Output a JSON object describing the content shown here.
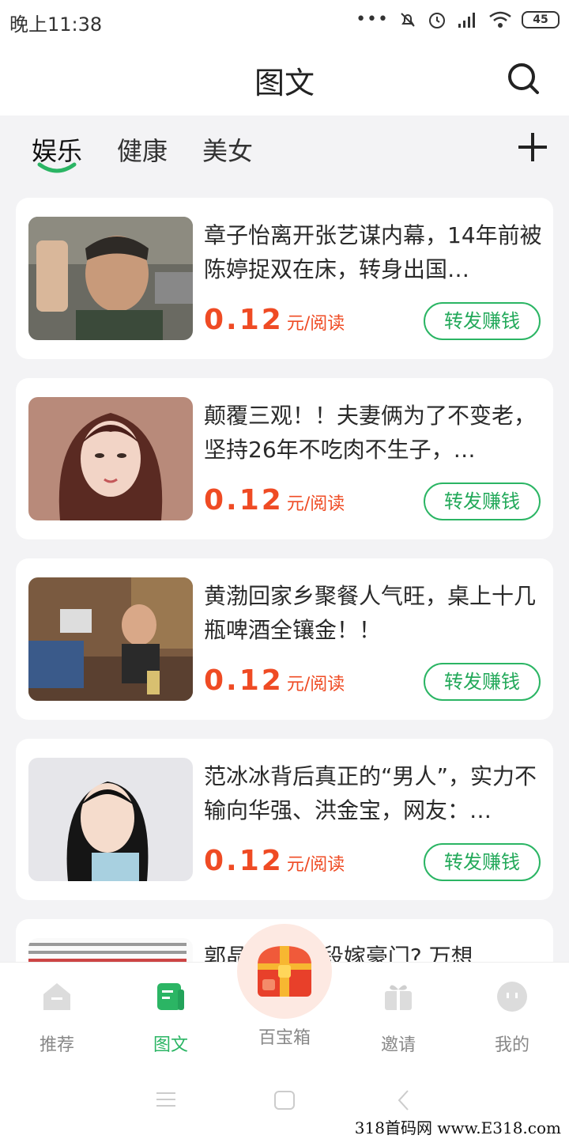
{
  "status_bar": {
    "time": "晚上11:38",
    "battery": "45"
  },
  "header": {
    "title": "图文",
    "search_icon": "search-icon"
  },
  "tabs": [
    {
      "label": "娱乐",
      "active": true
    },
    {
      "label": "健康",
      "active": false
    },
    {
      "label": "美女",
      "active": false
    }
  ],
  "add_icon": "plus-icon",
  "articles": [
    {
      "title": "章子怡离开张艺谋内幕，14年前被陈婷捉双在床，转身出国…",
      "price": "0.12",
      "unit": "元/阅读",
      "action": "转发赚钱"
    },
    {
      "title": "颠覆三观！！夫妻俩为了不变老，坚持26年不吃肉不生子，…",
      "price": "0.12",
      "unit": "元/阅读",
      "action": "转发赚钱"
    },
    {
      "title": "黄渤回家乡聚餐人气旺，桌上十几瓶啤酒全镶金！！",
      "price": "0.12",
      "unit": "元/阅读",
      "action": "转发赚钱"
    },
    {
      "title": "范冰冰背后真正的“男人”，实力不输向华强、洪金宝，网友：…",
      "price": "0.12",
      "unit": "元/阅读",
      "action": "转发赚钱"
    },
    {
      "title": "郭晶 曝靠手段嫁豪门? 万想"
    }
  ],
  "bottom_nav": [
    {
      "label": "推荐",
      "icon": "home-icon",
      "active": false
    },
    {
      "label": "图文",
      "icon": "article-icon",
      "active": true
    },
    {
      "label": "百宝箱",
      "icon": "treasure-chest-icon",
      "active": false
    },
    {
      "label": "邀请",
      "icon": "gift-icon",
      "active": false
    },
    {
      "label": "我的",
      "icon": "profile-icon",
      "active": false
    }
  ],
  "watermark": "318首码网 www.E318.com",
  "colors": {
    "accent_green": "#2bb564",
    "price_red": "#ef4b24"
  }
}
